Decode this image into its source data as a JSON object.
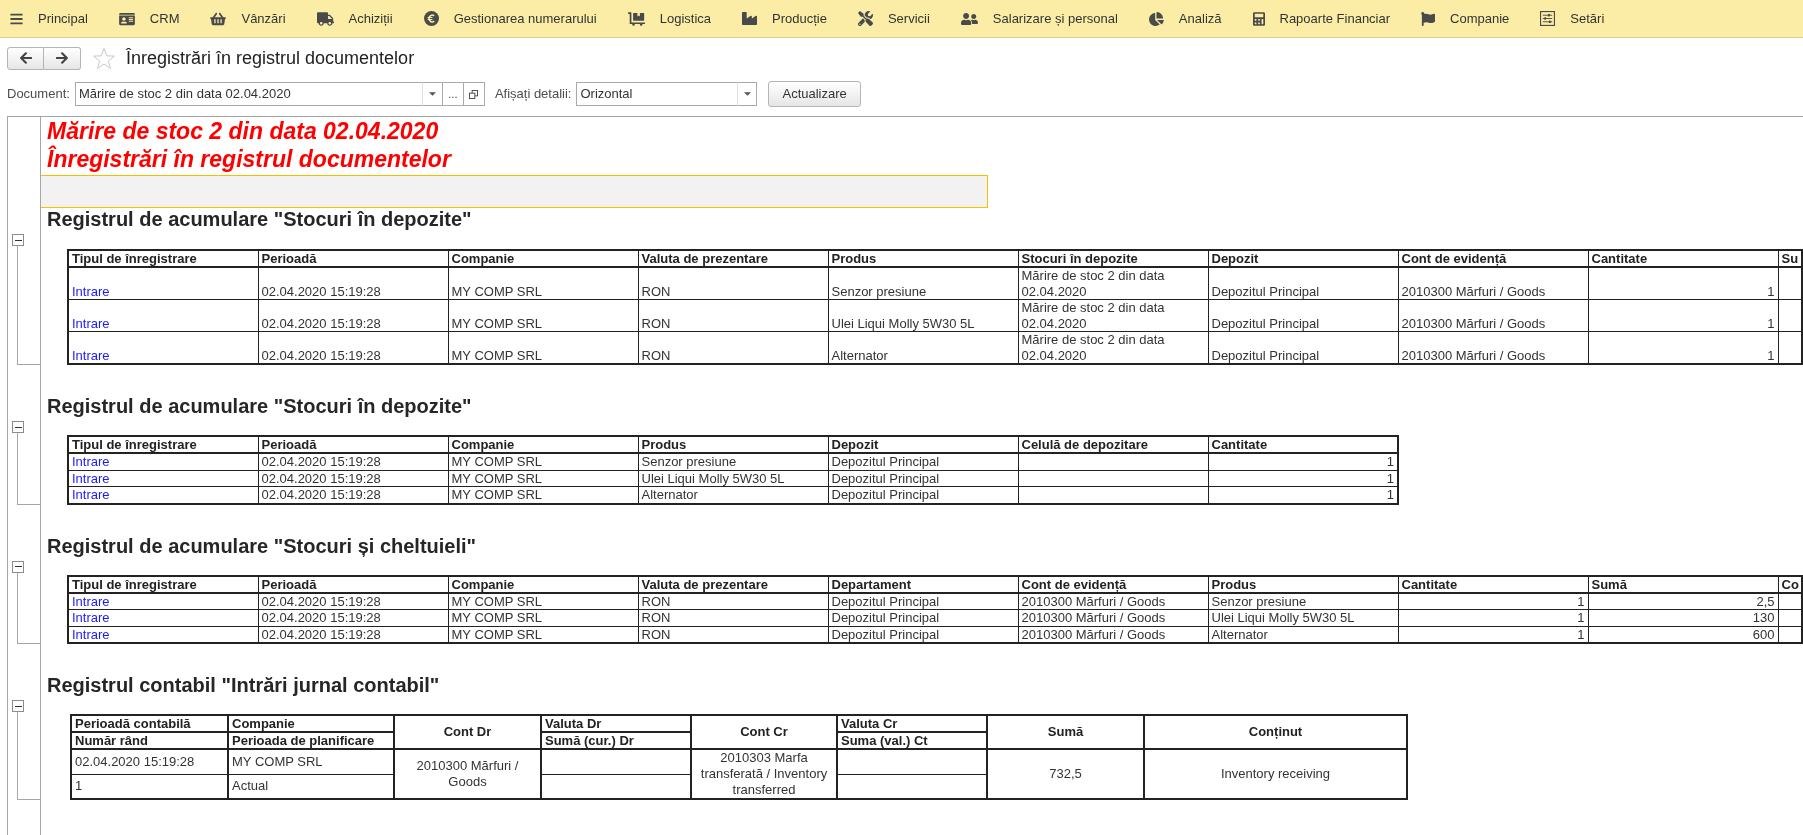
{
  "menu": [
    "Principal",
    "CRM",
    "Vânzări",
    "Achiziții",
    "Gestionarea numerarului",
    "Logistica",
    "Producție",
    "Servicii",
    "Salarizare și personal",
    "Analiză",
    "Rapoarte Financiar",
    "Companie",
    "Setări"
  ],
  "page": {
    "title": "Înregistrări în registrul documentelor",
    "favorite": false
  },
  "filters": {
    "document_label": "Document:",
    "document_value": "Mărire de stoc 2 din data 02.04.2020",
    "choose_button": "...",
    "details_label": "Afișați detalii:",
    "details_value": "Orizontal",
    "refresh_button": "Actualizare"
  },
  "report": {
    "title_lines": [
      "Mărire de stoc 2 din data 02.04.2020",
      "Înregistrări în registrul documentelor"
    ],
    "sections": [
      {
        "heading": "Registrul de acumulare \"Stocuri în depozite\"",
        "kind": "register",
        "expanded": true,
        "columns": [
          {
            "label": "Tipul de înregistrare",
            "kind": "link"
          },
          {
            "label": "Perioadă",
            "kind": "text"
          },
          {
            "label": "Companie",
            "kind": "text"
          },
          {
            "label": "Valuta de prezentare",
            "kind": "text"
          },
          {
            "label": "Produs",
            "kind": "text"
          },
          {
            "label": "Stocuri în depozite",
            "kind": "text"
          },
          {
            "label": "Depozit",
            "kind": "text"
          },
          {
            "label": "Cont de evidență",
            "kind": "text"
          },
          {
            "label": "Cantitate",
            "kind": "number"
          },
          {
            "label": "Su"
          }
        ],
        "rows": [
          [
            "Intrare",
            "02.04.2020 15:19:28",
            "MY COMP SRL",
            "RON",
            "Senzor presiune",
            "Mărire de stoc 2 din data 02.04.2020",
            "Depozitul Principal",
            "2010300 Mărfuri / Goods",
            "1"
          ],
          [
            "Intrare",
            "02.04.2020 15:19:28",
            "MY COMP SRL",
            "RON",
            "Ulei Liqui Molly 5W30 5L",
            "Mărire de stoc 2 din data 02.04.2020",
            "Depozitul Principal",
            "2010300 Mărfuri / Goods",
            "1"
          ],
          [
            "Intrare",
            "02.04.2020 15:19:28",
            "MY COMP SRL",
            "RON",
            "Alternator",
            "Mărire de stoc 2 din data 02.04.2020",
            "Depozitul Principal",
            "2010300 Mărfuri / Goods",
            "1"
          ]
        ]
      },
      {
        "heading": "Registrul de acumulare \"Stocuri în depozite\"",
        "kind": "register",
        "expanded": true,
        "columns": [
          {
            "label": "Tipul de înregistrare",
            "kind": "link"
          },
          {
            "label": "Perioadă",
            "kind": "text"
          },
          {
            "label": "Companie",
            "kind": "text"
          },
          {
            "label": "Produs",
            "kind": "text"
          },
          {
            "label": "Depozit",
            "kind": "text"
          },
          {
            "label": "Celulă de depozitare"
          },
          {
            "label": "Cantitate",
            "kind": "number"
          }
        ],
        "rows": [
          [
            "Intrare",
            "02.04.2020 15:19:28",
            "MY COMP SRL",
            "Senzor presiune",
            "Depozitul Principal",
            null,
            "1"
          ],
          [
            "Intrare",
            "02.04.2020 15:19:28",
            "MY COMP SRL",
            "Ulei Liqui Molly 5W30 5L",
            "Depozitul Principal",
            null,
            "1"
          ],
          [
            "Intrare",
            "02.04.2020 15:19:28",
            "MY COMP SRL",
            "Alternator",
            "Depozitul Principal",
            null,
            "1"
          ]
        ]
      },
      {
        "heading": "Registrul de acumulare \"Stocuri și cheltuieli\"",
        "kind": "register",
        "expanded": true,
        "columns": [
          {
            "label": "Tipul de înregistrare",
            "kind": "link"
          },
          {
            "label": "Perioadă",
            "kind": "text"
          },
          {
            "label": "Companie",
            "kind": "text"
          },
          {
            "label": "Valuta de prezentare",
            "kind": "text"
          },
          {
            "label": "Departament",
            "kind": "text"
          },
          {
            "label": "Cont de evidență",
            "kind": "text"
          },
          {
            "label": "Produs",
            "kind": "text"
          },
          {
            "label": "Cantitate",
            "kind": "number"
          },
          {
            "label": "Sumă",
            "kind": "number"
          },
          {
            "label": "Co"
          }
        ],
        "rows": [
          [
            "Intrare",
            "02.04.2020 15:19:28",
            "MY COMP SRL",
            "RON",
            "Depozitul Principal",
            "2010300 Mărfuri / Goods",
            "Senzor presiune",
            "1",
            "2,5"
          ],
          [
            "Intrare",
            "02.04.2020 15:19:28",
            "MY COMP SRL",
            "RON",
            "Depozitul Principal",
            "2010300 Mărfuri / Goods",
            "Ulei Liqui Molly 5W30 5L",
            "1",
            "130"
          ],
          [
            "Intrare",
            "02.04.2020 15:19:28",
            "MY COMP SRL",
            "RON",
            "Depozitul Principal",
            "2010300 Mărfuri / Goods",
            "Alternator",
            "1",
            "600"
          ]
        ]
      },
      {
        "heading": "Registrul contabil \"Intrări jurnal contabil\"",
        "kind": "journal",
        "expanded": true,
        "columns": [
          {
            "kind": "split",
            "labels": [
              "Perioadă contabilă",
              "Număr rând"
            ]
          },
          {
            "kind": "split",
            "labels": [
              "Companie",
              "Perioada de planificare"
            ]
          },
          {
            "kind": "single",
            "label": "Cont Dr"
          },
          {
            "kind": "split",
            "labels": [
              "Valuta Dr",
              "Sumă (cur.) Dr"
            ]
          },
          {
            "kind": "single",
            "label": "Cont Cr"
          },
          {
            "kind": "split",
            "labels": [
              "Valuta Cr",
              "Suma (val.) Ct"
            ]
          },
          {
            "kind": "single",
            "label": "Sumă"
          },
          {
            "kind": "single",
            "label": "Conținut"
          }
        ],
        "rows": [
          [
            [
              "02.04.2020 15:19:28",
              "1"
            ],
            [
              "MY COMP SRL",
              "Actual"
            ],
            "2010300 Mărfuri / Goods",
            [
              null,
              null
            ],
            "2010303 Marfa transferată / Inventory transferred",
            [
              null,
              null
            ],
            "732,5",
            "Inventory receiving"
          ]
        ]
      }
    ]
  }
}
